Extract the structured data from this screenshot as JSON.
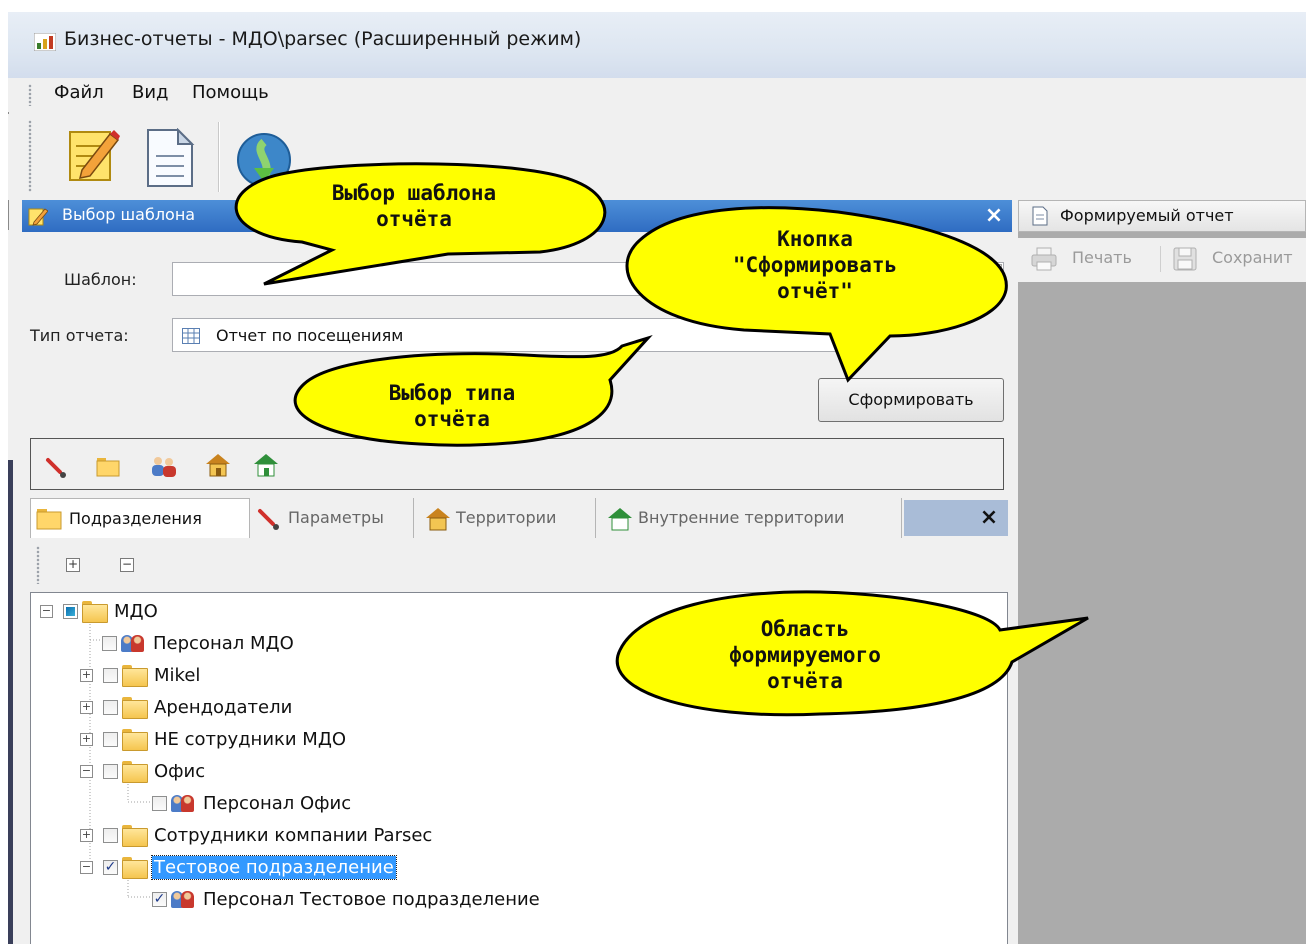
{
  "window": {
    "title": "Бизнес-отчеты - МДО\\parsec (Расширенный режим)"
  },
  "menu": [
    "Файл",
    "Вид",
    "Помощь"
  ],
  "left_panel": {
    "title": "Выбор шаблона",
    "template_label": "Шаблон:",
    "template_value": "",
    "report_type_label": "Тип отчета:",
    "report_type_value": "Отчет по посещениям",
    "form_button": "Сформировать"
  },
  "tabs": [
    {
      "label": "Подразделения",
      "icon": "folder-icon",
      "active": true
    },
    {
      "label": "Параметры",
      "icon": "brush-icon",
      "active": false
    },
    {
      "label": "Территории",
      "icon": "house-icon",
      "active": false
    },
    {
      "label": "Внутренние территории",
      "icon": "house-green-icon",
      "active": false
    }
  ],
  "tree": [
    {
      "label": "МДО",
      "level": 0,
      "expander": "minus",
      "check": "partial",
      "icon": "folder"
    },
    {
      "label": "Персонал МДО",
      "level": 1,
      "expander": "none",
      "check": "unchecked",
      "icon": "people"
    },
    {
      "label": "Mikel",
      "level": 1,
      "expander": "plus",
      "check": "unchecked",
      "icon": "folder"
    },
    {
      "label": "Арендодатели",
      "level": 1,
      "expander": "plus",
      "check": "unchecked",
      "icon": "folder"
    },
    {
      "label": "НЕ сотрудники МДО",
      "level": 1,
      "expander": "plus",
      "check": "unchecked",
      "icon": "folder"
    },
    {
      "label": "Офис",
      "level": 1,
      "expander": "minus",
      "check": "unchecked",
      "icon": "folder"
    },
    {
      "label": "Персонал Офис",
      "level": 2,
      "expander": "none",
      "check": "unchecked",
      "icon": "people"
    },
    {
      "label": "Сотрудники компании Parsec",
      "level": 1,
      "expander": "plus",
      "check": "unchecked",
      "icon": "folder"
    },
    {
      "label": "Тестовое подразделение",
      "level": 1,
      "expander": "minus",
      "check": "checked",
      "icon": "folder",
      "selected": true
    },
    {
      "label": "Персонал Тестовое подразделение",
      "level": 2,
      "expander": "none",
      "check": "checked",
      "icon": "people"
    }
  ],
  "right_panel": {
    "title": "Формируемый отчет",
    "print": "Печать",
    "save": "Сохранит"
  },
  "callouts": {
    "template": [
      "Выбор шаблона",
      "отчёта"
    ],
    "button": [
      "Кнопка",
      "\"Сформировать",
      "отчёт\""
    ],
    "type": [
      "Выбор типа",
      "отчёта"
    ],
    "area": [
      "Область",
      "формируемого",
      "отчёта"
    ]
  },
  "colors": {
    "panel_header": "#2f6cc2",
    "callout_fill": "#ffff00",
    "selection": "#3399ff",
    "report_area": "#ababab"
  }
}
